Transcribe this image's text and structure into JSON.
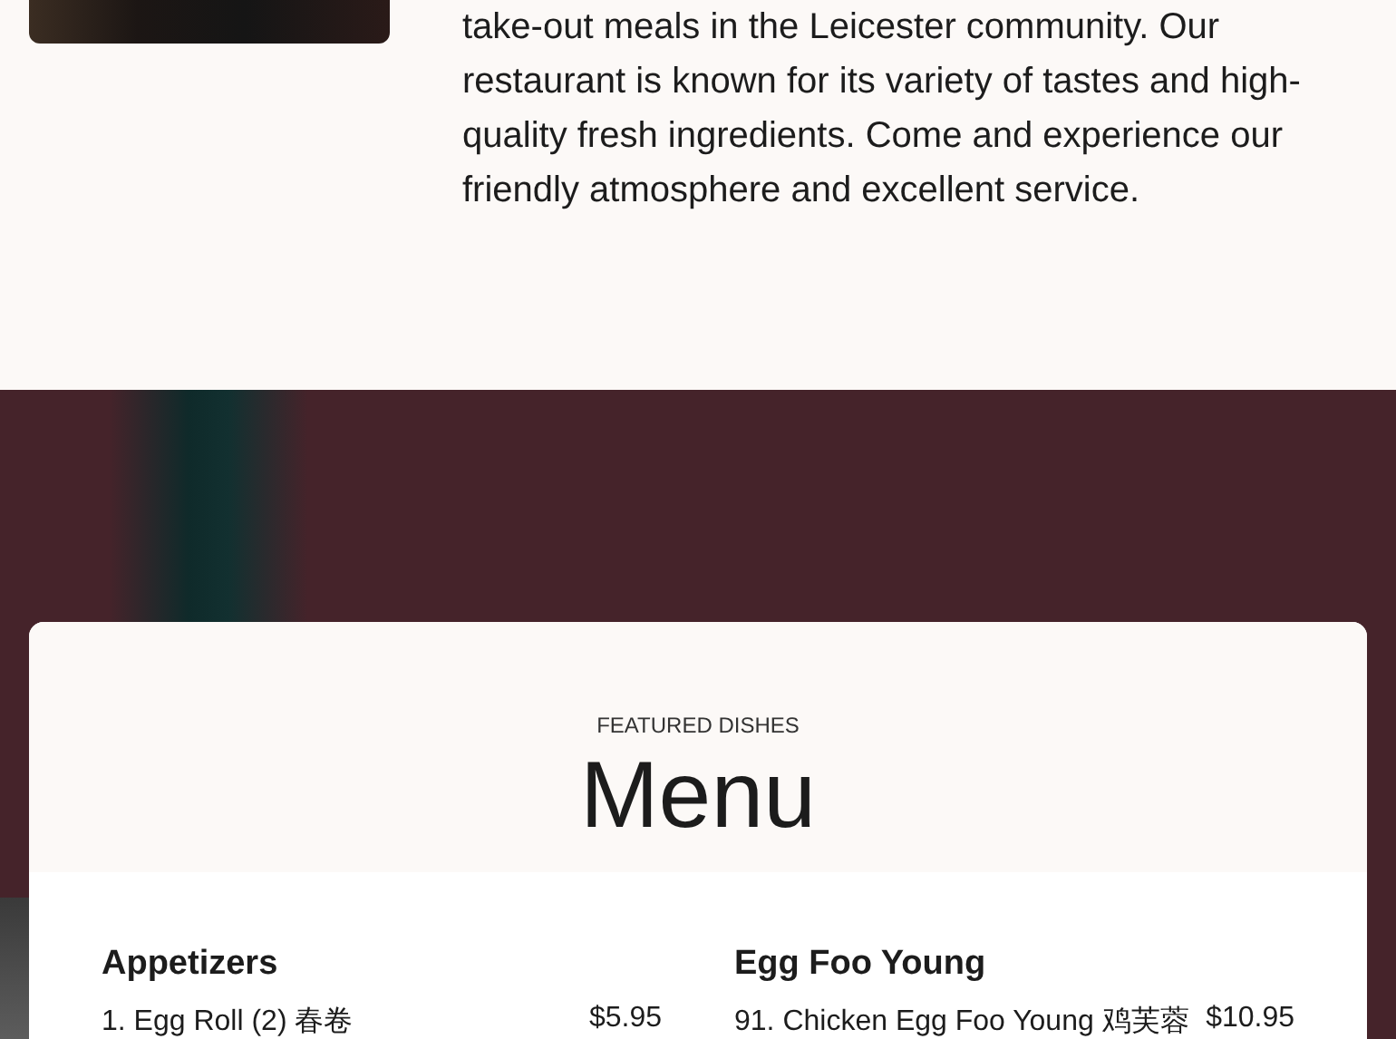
{
  "about": {
    "paragraph": "take-out meals in the Leicester community. Our restaurant is known for its variety of tastes and high-quality fresh ingredients. Come and experience our friendly atmosphere and excellent service."
  },
  "menu": {
    "eyebrow": "FEATURED DISHES",
    "title": "Menu",
    "sections": [
      {
        "heading": "Appetizers",
        "items": [
          {
            "name": "1. Egg Roll (2) 春卷",
            "price": "$5.95"
          }
        ]
      },
      {
        "heading": "Egg Foo Young",
        "items": [
          {
            "name": "91. Chicken Egg Foo Young 鸡芙蓉",
            "price": "$10.95"
          }
        ]
      }
    ]
  }
}
